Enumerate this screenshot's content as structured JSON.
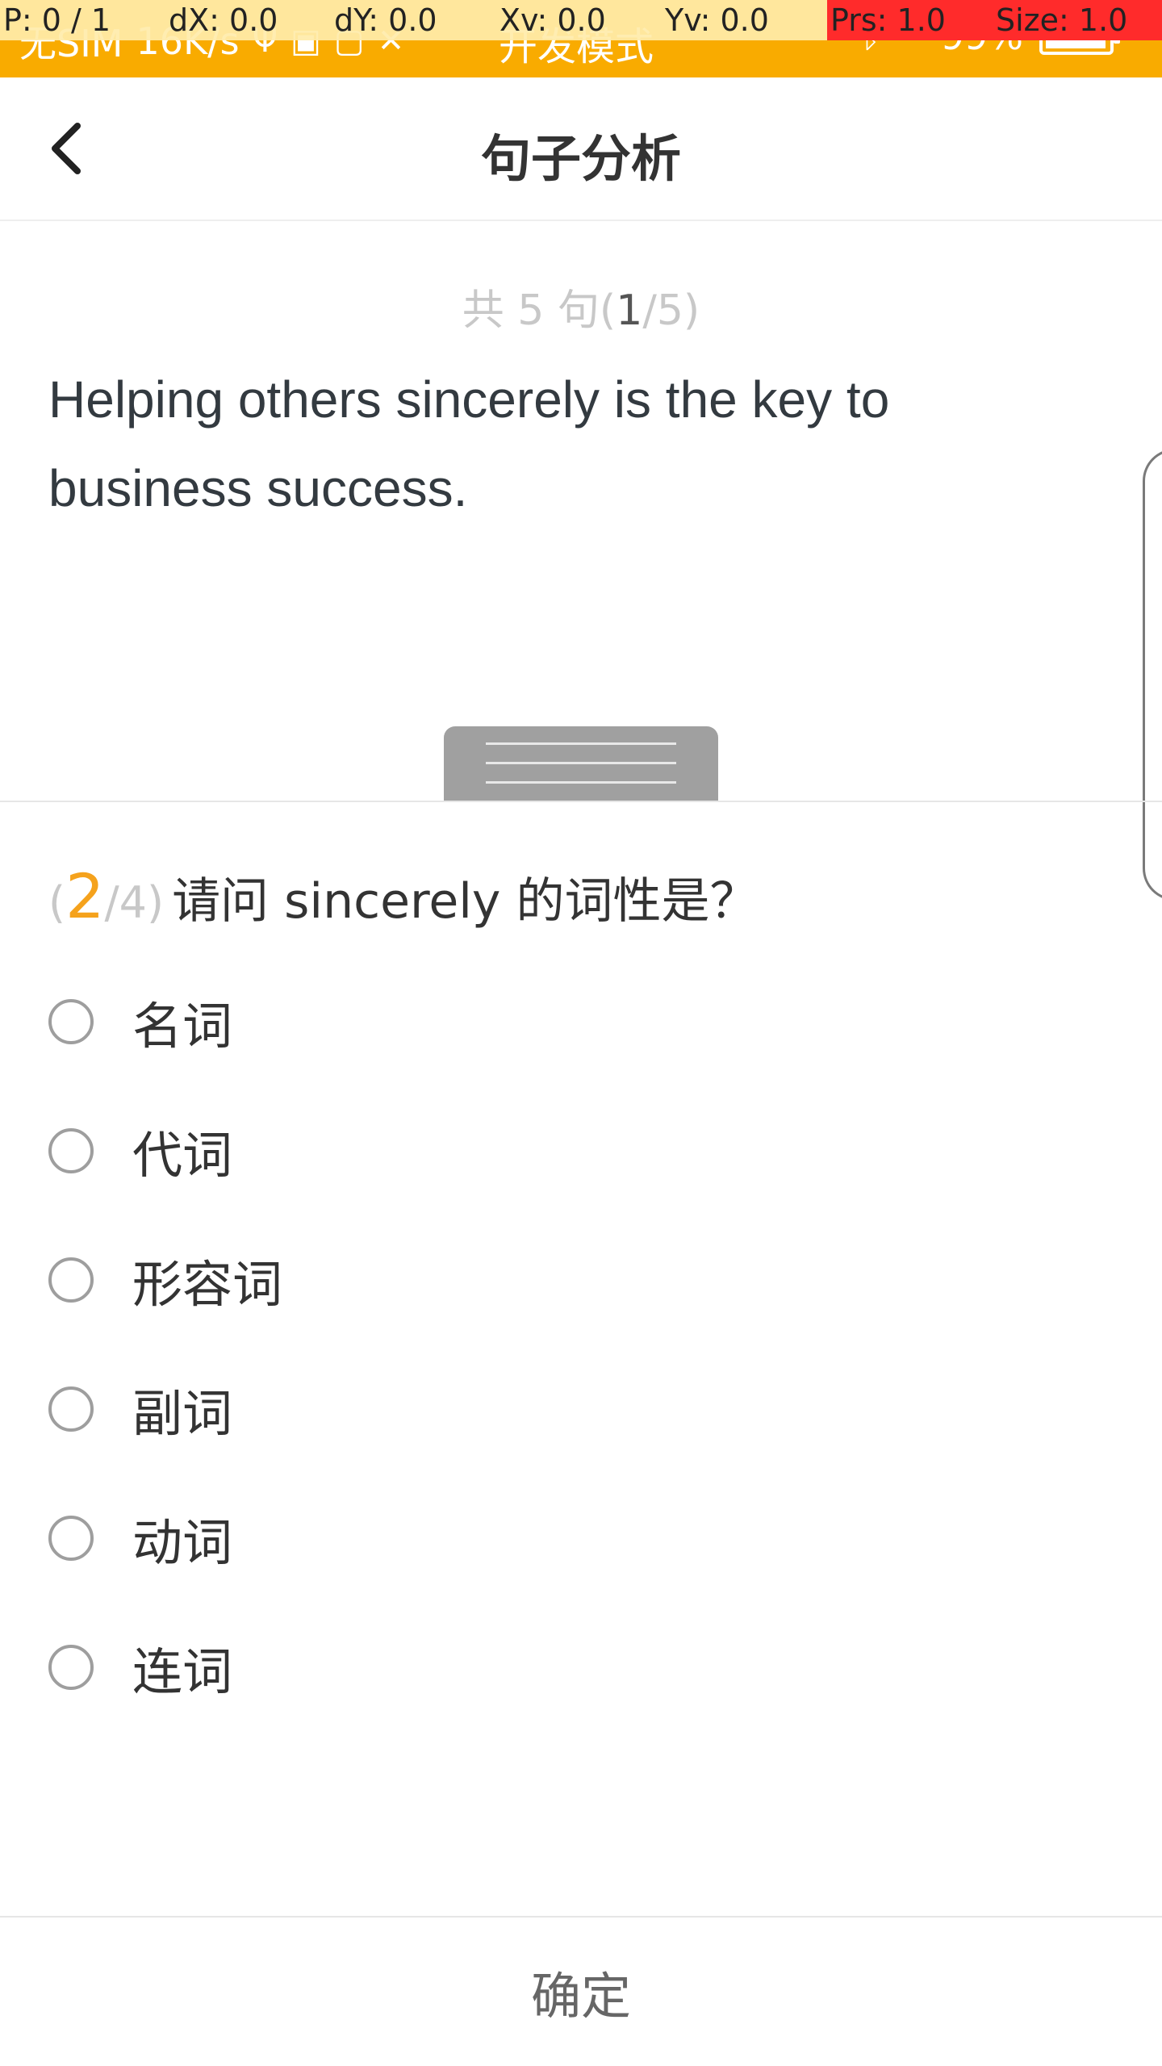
{
  "status_bar": {
    "carrier": "无SIM",
    "speed": "16K/s",
    "mode": "开发模式",
    "battery": "99%"
  },
  "debug_overlay": {
    "p": "P: 0 / 1",
    "dx": "dX: 0.0",
    "dy": "dY: 0.0",
    "xv": "Xv: 0.0",
    "yv": "Yv: 0.0",
    "prs": "Prs: 1.0",
    "size": "Size: 1.0"
  },
  "header": {
    "title": "句子分析",
    "back_icon": "chevron-left-icon"
  },
  "sentence": {
    "counter_prefix": "共 5 句(",
    "counter_current": "1",
    "counter_suffix": "/5)",
    "text": "Helping others sincerely is the key to business success."
  },
  "question": {
    "open_paren": "(",
    "current": "2",
    "total": "/4)",
    "text": "请问 sincerely 的词性是？"
  },
  "options": [
    {
      "label": "名词"
    },
    {
      "label": "代词"
    },
    {
      "label": "形容词"
    },
    {
      "label": "副词"
    },
    {
      "label": "动词"
    },
    {
      "label": "连词"
    }
  ],
  "footer": {
    "confirm_label": "确定"
  },
  "colors": {
    "status_bar": "#f9ab00",
    "accent": "#f5a21c",
    "debug_red": "#ff2b2b"
  }
}
